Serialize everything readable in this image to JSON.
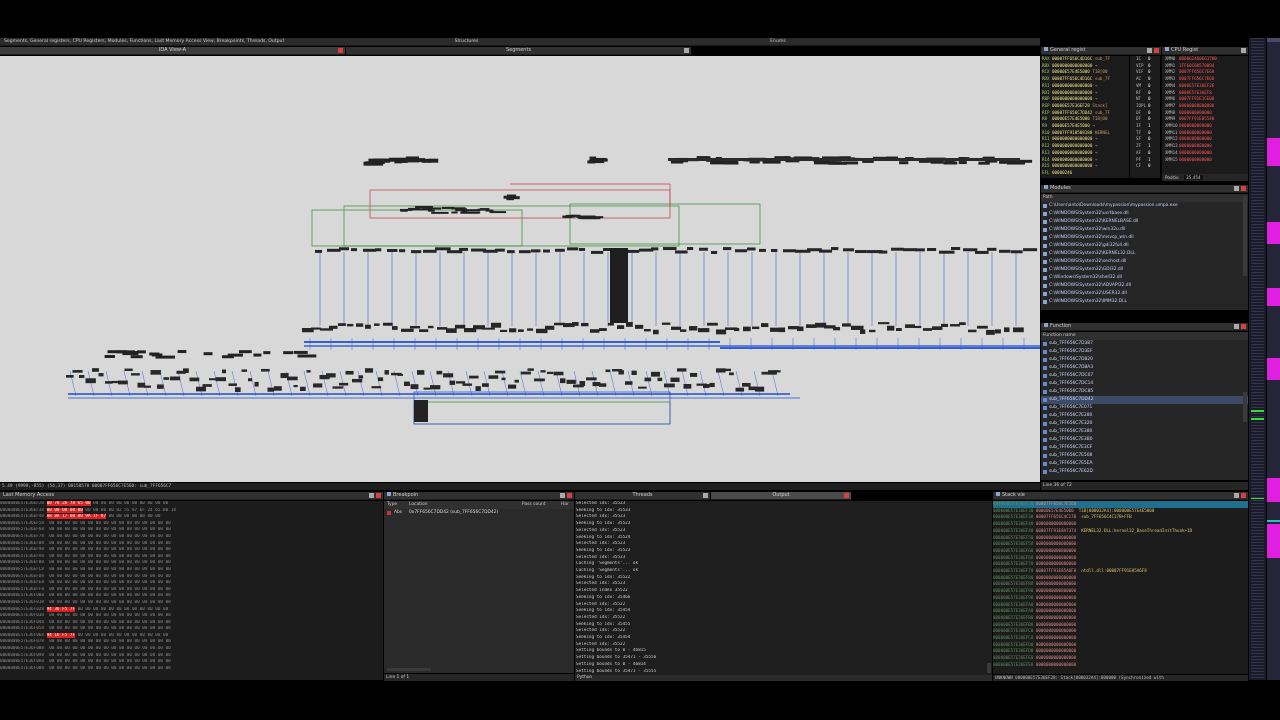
{
  "top_tabs": {
    "left_label": "Segments, General registers, CPU Registers, Modules, Functions, Last Memory Access View, Breakpoints, Threads, Output",
    "structures": "Structures",
    "enums": "Enums"
  },
  "ida_view": {
    "title": "IDA View-A",
    "segments_title": "Segments",
    "status_line": "5.49 (9999,-855) (54,37) 00150570 00007FF656C7E560: sub_7FF656C7"
  },
  "general_registers": {
    "title": "General regist",
    "rows": [
      {
        "name": "RAX",
        "value": "00007FF656C4D16C",
        "ann": "sub_7F"
      },
      {
        "name": "RBX",
        "value": "0000000000000000",
        "ann": "→"
      },
      {
        "name": "RCX",
        "value": "00000E57E4E5000",
        "ann": "TIB[00"
      },
      {
        "name": "RDX",
        "value": "00007FF656C4D16C",
        "ann": "sub_7F"
      },
      {
        "name": "RSI",
        "value": "0000000000000000",
        "ann": "→"
      },
      {
        "name": "RDI",
        "value": "0000000000000000",
        "ann": "→"
      },
      {
        "name": "RBP",
        "value": "0000000000000000",
        "ann": "→"
      },
      {
        "name": "RSP",
        "value": "00000E57E36EF28",
        "ann": "Stack["
      },
      {
        "name": "RIP",
        "value": "00007FF656C7DD42",
        "ann": "sub_7F"
      },
      {
        "name": "R8",
        "value": "00000E57E4E5000",
        "ann": "TIB[00"
      },
      {
        "name": "R9",
        "value": "00000E57E4E5000",
        "ann": "→"
      },
      {
        "name": "R10",
        "value": "00007FF918588180",
        "ann": "KERNEL"
      },
      {
        "name": "R11",
        "value": "0000000000000000",
        "ann": "→"
      },
      {
        "name": "R12",
        "value": "0000000000000000",
        "ann": "→"
      },
      {
        "name": "R13",
        "value": "0000000000000000",
        "ann": "→"
      },
      {
        "name": "R14",
        "value": "0000000000000000",
        "ann": "→"
      },
      {
        "name": "R15",
        "value": "0000000000000000",
        "ann": "→"
      },
      {
        "name": "EFL",
        "value": "00000246",
        "ann": ""
      }
    ],
    "flags": [
      {
        "name": "IC",
        "value": "0"
      },
      {
        "name": "VIP",
        "value": "0"
      },
      {
        "name": "VIF",
        "value": "0"
      },
      {
        "name": "AC",
        "value": "0"
      },
      {
        "name": "VM",
        "value": "0"
      },
      {
        "name": "RF",
        "value": "0"
      },
      {
        "name": "NT",
        "value": "0"
      },
      {
        "name": "IOPL",
        "value": "0"
      },
      {
        "name": "OF",
        "value": "0"
      },
      {
        "name": "DF",
        "value": "0"
      },
      {
        "name": "IF",
        "value": "1"
      },
      {
        "name": "TF",
        "value": "0"
      },
      {
        "name": "SF",
        "value": "0"
      },
      {
        "name": "ZF",
        "value": "1"
      },
      {
        "name": "AF",
        "value": "0"
      },
      {
        "name": "PF",
        "value": "1"
      },
      {
        "name": "CF",
        "value": "0"
      }
    ]
  },
  "cpu_registers": {
    "title": "CPU Regist",
    "rows": [
      {
        "name": "XMM0",
        "value": "0B0062460E63780"
      },
      {
        "name": "XMM1",
        "value": "1FF60C00570004"
      },
      {
        "name": "XMM2",
        "value": "0007FF656C7E68"
      },
      {
        "name": "XMM3",
        "value": "0007FF656C7E68"
      },
      {
        "name": "XMM4",
        "value": "0000E57E36EF2E"
      },
      {
        "name": "XMM5",
        "value": "0000E57E36EF8"
      },
      {
        "name": "XMM6",
        "value": "0007FF91E1CE00"
      },
      {
        "name": "XMM7",
        "value": "00000000000000"
      },
      {
        "name": "XMM8",
        "value": "0000000000000"
      },
      {
        "name": "XMM9",
        "value": "0007FF91E85540"
      },
      {
        "name": "XMM10",
        "value": "0000000000000"
      },
      {
        "name": "XMM11",
        "value": "0000000000000"
      },
      {
        "name": "XMM12",
        "value": "0000000000000"
      },
      {
        "name": "XMM13",
        "value": "0000000000000"
      },
      {
        "name": "XMM14",
        "value": "0000000000000"
      },
      {
        "name": "XMM15",
        "value": "0000000000000"
      }
    ],
    "position_label": "Positio",
    "position_value": "35,454"
  },
  "modules": {
    "title": "Modules",
    "col_path": "Path",
    "rows": [
      "C:\\Users\\anto\\Downloads\\mypassion\\mypassion.umpa.exe",
      "C:\\WINDOWS\\System32\\ucrtbase.dll",
      "C:\\WINDOWS\\System32\\KERNELBASE.dll",
      "C:\\WINDOWS\\System32\\win32u.dll",
      "C:\\WINDOWS\\System32\\msvcp_win.dll",
      "C:\\WINDOWS\\System32\\gdi32full.dll",
      "C:\\WINDOWS\\System32\\KERNEL32.DLL",
      "C:\\WINDOWS\\System32\\sechost.dll",
      "C:\\WINDOWS\\System32\\GDI32.dll",
      "C:\\Windows\\System32\\shell32.dll",
      "C:\\WINDOWS\\System32\\ADVAPI32.dll",
      "C:\\WINDOWS\\System32\\USER32.dll",
      "C:\\WINDOWS\\System32\\IMM32.DLL"
    ]
  },
  "functions": {
    "title": "Function",
    "col_name": "Function name",
    "rows": [
      "sub_7FF656C7D387",
      "sub_7FF656C7D3EF",
      "sub_7FF656C7D820",
      "sub_7FF656C7D8A3",
      "sub_7FF656C7DC07",
      "sub_7FF656C7DC14",
      "sub_7FF656C7DC85",
      "sub_7FF656C7DD42",
      "sub_7FF656C7E071",
      "sub_7FF656C7E280",
      "sub_7FF656C7E320",
      "sub_7FF656C7E380",
      "sub_7FF656C7E3B0",
      "sub_7FF656C7E3CF",
      "sub_7FF656C7E508",
      "sub_7FF656C7E5EA",
      "sub_7FF656C7E62D"
    ],
    "selected_index": 7,
    "status": "Line 36 of 72"
  },
  "last_memory": {
    "title": "Last Memory Access",
    "rows": [
      {
        "addr": "0000000E57E36EF28",
        "hl": "00 78 26 78 65 00",
        "rest": "00 00 00 00 00 00 00 00 00 00"
      },
      {
        "addr": "0000000E57E36EF38",
        "hl": "00 00 00 00 00",
        "rest": "00 00 00 00 82 55 87 6F 24 65 B0 18"
      },
      {
        "addr": "0000000E57E36EF48",
        "hl": "A8 8A 17 00 00 9A 1F 87",
        "rest": "00 00 00 00 00 00 00"
      },
      {
        "addr": "0000000E57E36EF58",
        "hl": "",
        "rest": "00 00 00 00 00 00 00 00 00 00 00 00 00 00 00 00"
      },
      {
        "addr": "0000000E57E36EF68",
        "hl": "",
        "rest": "00 00 00 00 00 00 00 00 00 00 00 00 00 00 00 00"
      },
      {
        "addr": "0000000E57E36EF78",
        "hl": "",
        "rest": "00 00 00 00 00 00 00 00 00 00 00 00 00 00 00 00"
      },
      {
        "addr": "0000000E57E36EF88",
        "hl": "",
        "rest": "00 00 00 00 00 00 00 00 00 00 00 00 00 00 00 00"
      },
      {
        "addr": "0000000E57E36EF98",
        "hl": "",
        "rest": "00 00 00 00 00 00 00 00 00 00 00 00 00 00 00 00"
      },
      {
        "addr": "0000000E57E36EFA8",
        "hl": "",
        "rest": "00 00 00 00 00 00 00 00 00 00 00 00 00 00 00 00"
      },
      {
        "addr": "0000000E57E36EFB8",
        "hl": "",
        "rest": "00 00 00 00 00 00 00 00 00 00 00 00 00 00 00 00"
      },
      {
        "addr": "0000000E57E36EFC8",
        "hl": "",
        "rest": "00 00 00 00 00 00 00 00 00 00 00 00 00 00 00 00"
      },
      {
        "addr": "0000000E57E36EFD8",
        "hl": "",
        "rest": "00 00 00 00 00 00 00 00 00 00 00 00 00 00 00 00"
      },
      {
        "addr": "0000000E57E36EFE8",
        "hl": "",
        "rest": "00 00 00 00 00 00 00 00 00 00 00 00 00 00 00 00"
      },
      {
        "addr": "0000000E57E36EFF8",
        "hl": "",
        "rest": "00 00 00 00 00 00 00 00 00 00 00 00 00 00 00 00"
      },
      {
        "addr": "0000000E57E36F008",
        "hl": "",
        "rest": "00 00 00 00 00 00 00 00 00 00 00 00 00 00 00 00"
      },
      {
        "addr": "0000000E57E36F018",
        "hl": "",
        "rest": "00 00 00 00 00 00 00 00 00 00 00 00 00 00 00 00"
      },
      {
        "addr": "0000000E57E36F028",
        "hl": "94 36 F5 7F",
        "rest": "00 00 00 00 00 00 00 00 00 00 00 00"
      },
      {
        "addr": "0000000E57E36F038",
        "hl": "",
        "rest": "00 00 00 00 00 00 00 00 00 00 00 00 00 00 00 00"
      },
      {
        "addr": "0000000E57E36F048",
        "hl": "",
        "rest": "00 00 00 00 00 00 00 00 00 00 00 00 00 00 00 00"
      },
      {
        "addr": "0000000E57E36F058",
        "hl": "",
        "rest": "00 00 00 00 00 00 00 00 00 00 00 00 00 00 00 00"
      },
      {
        "addr": "0000000E57E36F068",
        "hl": "94 16 F5 7F",
        "rest": "00 00 00 00 00 00 00 00 00 00 00 00"
      },
      {
        "addr": "0000000E57E36F078",
        "hl": "",
        "rest": "00 00 00 00 00 00 00 00 00 00 00 00 00 00 00 00"
      },
      {
        "addr": "0000000E57E36F088",
        "hl": "",
        "rest": "00 00 00 00 00 00 00 00 00 00 00 00 00 00 00 00"
      },
      {
        "addr": "0000000E57E36F098",
        "hl": "",
        "rest": "00 00 00 00 00 00 00 00 00 00 00 00 00 00 00 00"
      },
      {
        "addr": "0000000E57E36F0A8",
        "hl": "",
        "rest": "00 00 00 00 00 00 00 00 00 00 00 00 00 00 00 00"
      },
      {
        "addr": "0000000E57E36F0B8",
        "hl": "",
        "rest": "00 00 00 00 00 00 00 00 00 00 00 00 00 00 00 00"
      }
    ]
  },
  "breakpoints": {
    "title": "Breakpoin",
    "col_type": "Type",
    "col_location": "Location",
    "col_pass": "Pass count",
    "col_hw": "Har",
    "rows": [
      {
        "type": "Abs",
        "location": "0x7FF656C7DD42 (sub_7FF656C7DD42)"
      }
    ],
    "status": "Line 1 of 1"
  },
  "threads_tab": "Threads",
  "output": {
    "title": "Output",
    "lines": [
      "Selected idx: 35523",
      "Seeking to idx: 35533",
      "Selected idx: 35523",
      "Seeking to idx: 35523",
      "Selected idx: 35523",
      "Seeking to idx: 35524",
      "Selected idx: 35523",
      "Seeking to idx: 35523",
      "Selected idx: 35523",
      "Caching 'Segments'... ok",
      "Caching 'Segments'... ok",
      "Seeking to idx: 35522",
      "Selected idx: 35523",
      "Selected index 35522",
      "Seeking to idx: 35466",
      "Selected idx: 35522",
      "Seeking to idx: 35454",
      "Selected idx: 35522",
      "Seeking to idx: 35455",
      "Selected idx: 35522",
      "Seeking to idx: 35454",
      "Selected idx: 35522",
      "Setting bounds to 0 - 46815",
      "Setting bounds to 35471 - 35556",
      "Setting bounds to 0 - 46814",
      "Setting bounds to 35471 - 35555"
    ],
    "prompt": "Python"
  },
  "stack": {
    "title": "Stack vie",
    "rows": [
      {
        "addr": "000000E57E36EF28",
        "val": "00007FF656C7E560",
        "cmt": ""
      },
      {
        "addr": "000000E57E36EF30",
        "val": "00000E57E4E5000",
        "cmt": "TIB[000032A4]:000000E57E4E5000"
      },
      {
        "addr": "000000E57E36EF38",
        "val": "00007FF656C4C17B",
        "cmt": "sub_7FF656C4C17B+FFB"
      },
      {
        "addr": "000000E57E36EF40",
        "val": "0000000000000000",
        "cmt": ""
      },
      {
        "addr": "000000E57E36EF48",
        "val": "00007FF91E8A7374",
        "cmt": "KERNEL32.DLL:kernel32_BaseThreadInitThunk+1D"
      },
      {
        "addr": "000000E57E36EF50",
        "val": "0000000000000000",
        "cmt": ""
      },
      {
        "addr": "000000E57E36EF58",
        "val": "0000000000000000",
        "cmt": ""
      },
      {
        "addr": "000000E57E36EF60",
        "val": "0000000000000000",
        "cmt": ""
      },
      {
        "addr": "000000E57E36EF68",
        "val": "0000000000000000",
        "cmt": ""
      },
      {
        "addr": "000000E57E36EF70",
        "val": "0000000000000000",
        "cmt": ""
      },
      {
        "addr": "000000E57E36EF78",
        "val": "00007FF91E85A6F8",
        "cmt": "ntdll.dll:00007FF91E85A6F8"
      },
      {
        "addr": "000000E57E36EF80",
        "val": "0000000000000000",
        "cmt": ""
      },
      {
        "addr": "000000E57E36EF88",
        "val": "0000000000000000",
        "cmt": ""
      },
      {
        "addr": "000000E57E36EF90",
        "val": "0000000000000000",
        "cmt": ""
      },
      {
        "addr": "000000E57E36EF98",
        "val": "0000000000000000",
        "cmt": ""
      },
      {
        "addr": "000000E57E36EFA0",
        "val": "0000000000000000",
        "cmt": ""
      },
      {
        "addr": "000000E57E36EFA8",
        "val": "0000000000000000",
        "cmt": ""
      },
      {
        "addr": "000000E57E36EFB0",
        "val": "0000000000000000",
        "cmt": ""
      },
      {
        "addr": "000000E57E36EFB8",
        "val": "0000000000000000",
        "cmt": ""
      },
      {
        "addr": "000000E57E36EFC0",
        "val": "0000000000000000",
        "cmt": ""
      },
      {
        "addr": "000000E57E36EFC8",
        "val": "0000000000000000",
        "cmt": ""
      },
      {
        "addr": "000000E57E36EFD0",
        "val": "0000000000000000",
        "cmt": ""
      },
      {
        "addr": "000000E57E36EFD8",
        "val": "0000000000000000",
        "cmt": ""
      },
      {
        "addr": "000000E57E36EFE0",
        "val": "0000000000000000",
        "cmt": ""
      },
      {
        "addr": "000000E57E36EFE8",
        "val": "0000000000000000",
        "cmt": ""
      }
    ],
    "status": "UNKNOWN 000000E57E36EF28: Stack[000032A4]:000000 (Synchronized with"
  },
  "colors": {
    "graph_bg": "#d8d8d8",
    "accent_blue": "#1f4fd0",
    "edge_green": "#2e8b2e",
    "edge_red": "#c43a3a",
    "nav_magenta": "#e020e0",
    "nav_green": "#30e030"
  }
}
